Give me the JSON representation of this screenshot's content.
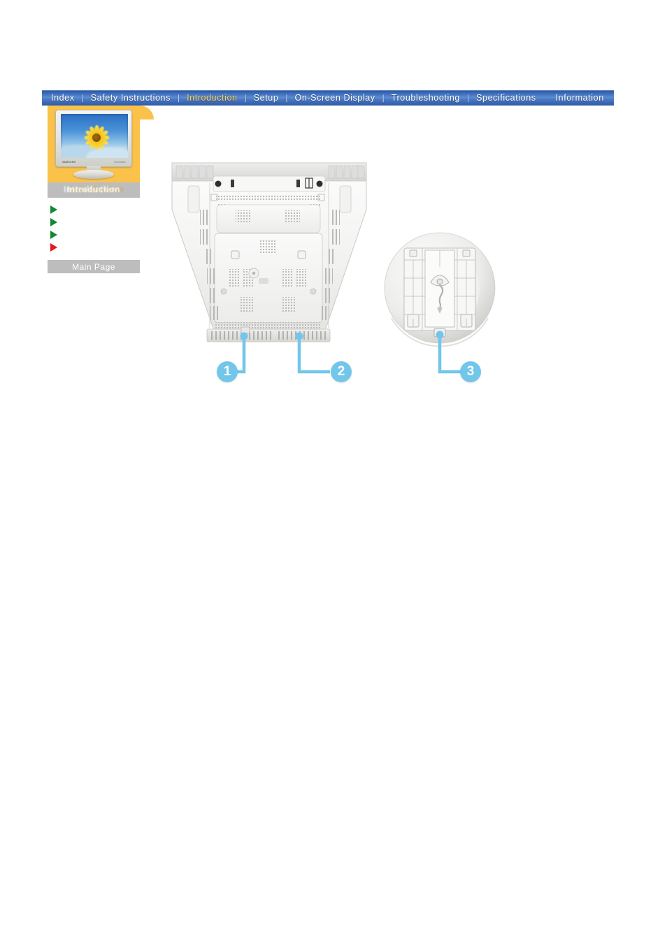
{
  "page": {
    "background_color": "#ffffff",
    "accent_blue": "#3a69b8",
    "accent_yellow": "#fbc24a",
    "callout_blue": "#72c6ea",
    "gray_band": "#bdbdbd"
  },
  "nav": {
    "active": "Introduction",
    "items": [
      {
        "label": "Index",
        "active": false
      },
      {
        "label": "Safety Instructions",
        "active": false
      },
      {
        "label": "Introduction",
        "active": true
      },
      {
        "label": "Setup",
        "active": false
      },
      {
        "label": "On-Screen Display",
        "active": false
      },
      {
        "label": "Troubleshooting",
        "active": false
      },
      {
        "label": "Specifications",
        "active": false
      },
      {
        "label": "Information",
        "active": false
      }
    ],
    "separator": "|"
  },
  "sidebar": {
    "thumbnail": {
      "icon": "monitor-thumbnail-icon",
      "brand": "SAMSUNG",
      "model": "SyncMaster",
      "screen_image": "sunflower-on-blue-sky"
    },
    "caption": "Introduction",
    "bullets": [
      {
        "marker": "green-triangle-icon",
        "color": "#0f8a33",
        "label": ""
      },
      {
        "marker": "green-triangle-icon",
        "color": "#0f8a33",
        "label": ""
      },
      {
        "marker": "green-triangle-icon",
        "color": "#0f8a33",
        "label": ""
      },
      {
        "marker": "red-triangle-icon",
        "color": "#e8161a",
        "label": ""
      }
    ],
    "main_page_button": "Main Page"
  },
  "diagrams": {
    "rear_view": {
      "name": "monitor-rear-chassis",
      "description": "Rear view of monitor chassis with ventilation slots"
    },
    "base_view": {
      "name": "monitor-stand-base",
      "description": "Underside view of circular monitor stand base"
    }
  },
  "callouts": [
    {
      "number": "1",
      "target": "rear-chassis-lower-left"
    },
    {
      "number": "2",
      "target": "rear-chassis-lower-right"
    },
    {
      "number": "3",
      "target": "stand-base-bottom-tab"
    }
  ]
}
